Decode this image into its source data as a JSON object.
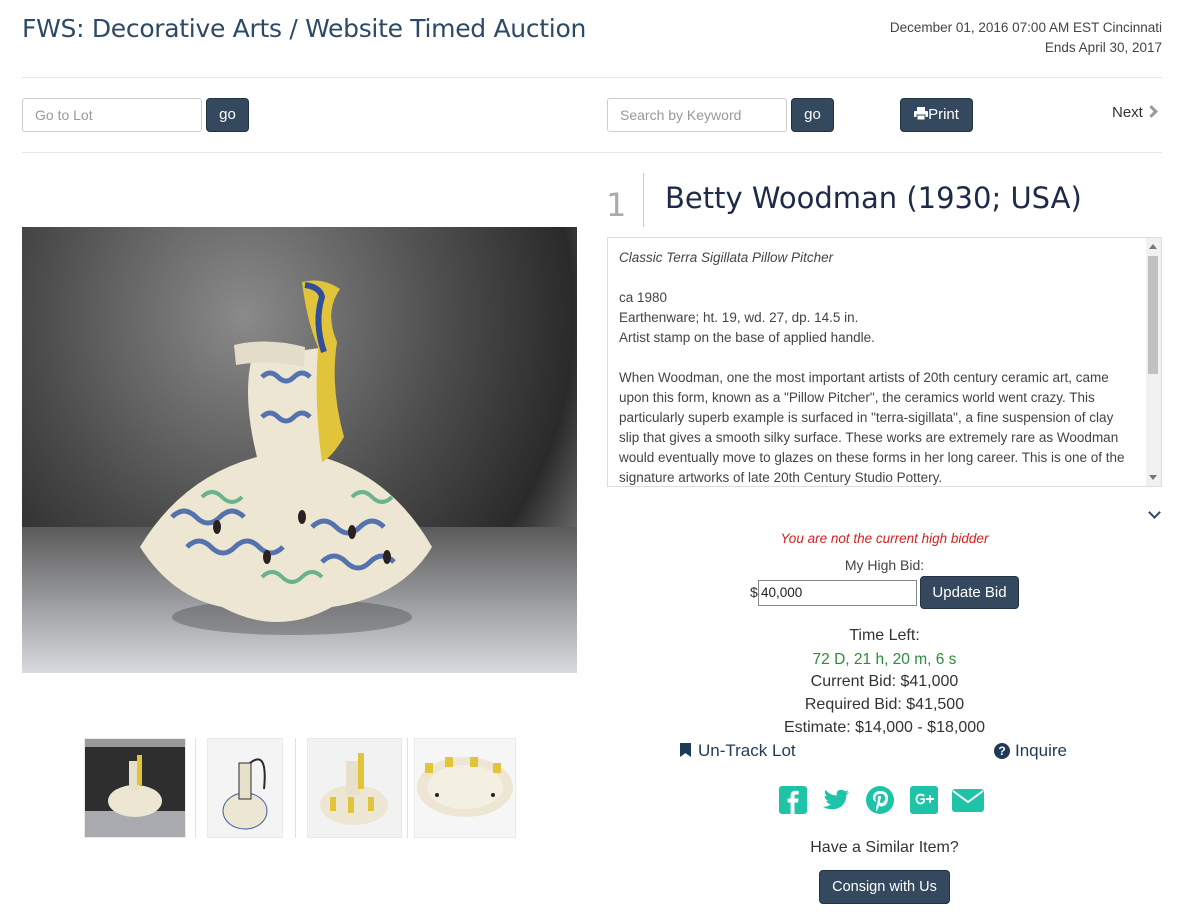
{
  "header": {
    "title": "FWS: Decorative Arts / Website Timed Auction",
    "date_line": "December 01, 2016 07:00 AM EST Cincinnati",
    "ends_line": "Ends April 30, 2017"
  },
  "toolbar": {
    "goto_placeholder": "Go to Lot",
    "goto_button": "go",
    "search_placeholder": "Search by Keyword",
    "search_button": "go",
    "print_label": "Print",
    "next_label": "Next"
  },
  "lot": {
    "number": "1",
    "title": "Betty Woodman (1930; USA)",
    "description": {
      "subtitle": "Classic Terra Sigillata Pillow Pitcher",
      "date": "ca 1980",
      "material": "Earthenware; ht. 19, wd. 27, dp. 14.5 in.",
      "stamp": "Artist stamp on the base of applied handle.",
      "body": "When Woodman, one the most important artists of 20th century ceramic art, came upon this form, known as a \"Pillow Pitcher\", the ceramics world went crazy. This particularly superb example is surfaced in \"terra-sigillata\", a fine suspension of clay slip that gives a smooth silky surface. These works are extremely rare as Woodman would eventually move to glazes on these forms in her long career. This is one of the signature artworks of late 20th Century Studio Pottery."
    }
  },
  "bidding": {
    "warning": "You are not the current high bidder",
    "my_high_bid_label": "My High Bid:",
    "currency_symbol": "$",
    "my_high_bid_value": "40,000",
    "update_button": "Update Bid",
    "time_left_label": "Time Left:",
    "time_left_value": "72 D, 21 h, 20 m, 6 s",
    "current_bid": "Current Bid: $41,000",
    "required_bid": "Required Bid: $41,500",
    "estimate": "Estimate: $14,000 - $18,000"
  },
  "actions": {
    "untrack_label": "Un-Track Lot",
    "inquire_label": "Inquire"
  },
  "social": [
    "facebook-icon",
    "twitter-icon",
    "pinterest-icon",
    "google-plus-icon",
    "email-icon"
  ],
  "consign": {
    "prompt": "Have a Similar Item?",
    "button": "Consign with Us"
  },
  "colors": {
    "brand_navy": "#34495e",
    "title_blue": "#2c4a66",
    "warning_red": "#d62020",
    "time_green": "#2e8b3a",
    "social_teal": "#1fc4a8"
  }
}
